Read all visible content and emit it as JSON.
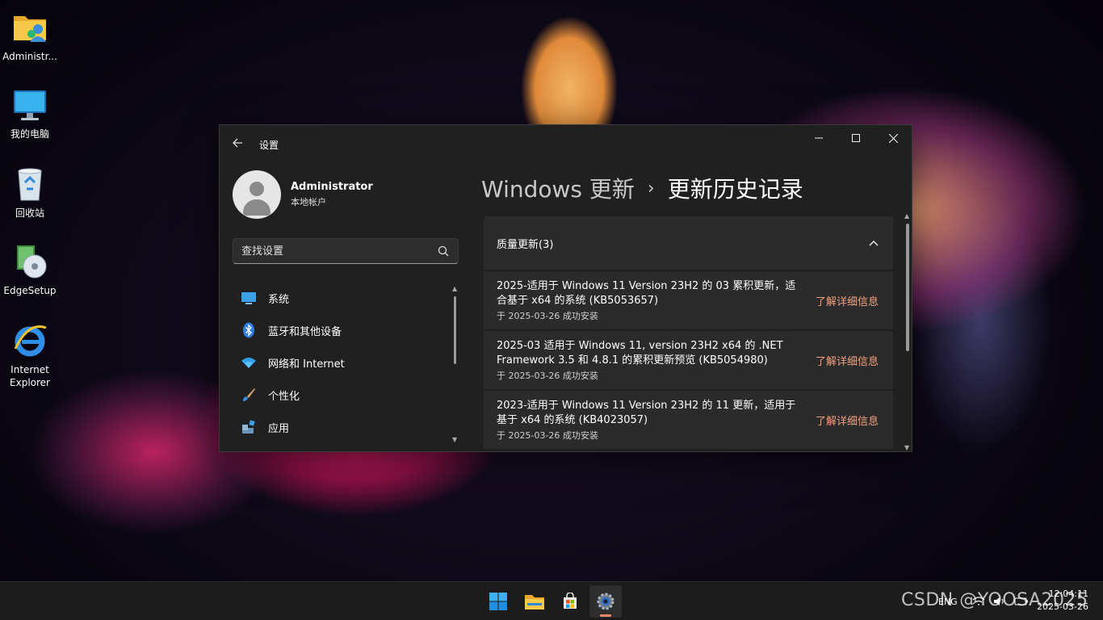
{
  "desktop": {
    "icons": [
      {
        "label": "Administr...",
        "icon": "user-folder-icon"
      },
      {
        "label": "我的电脑",
        "icon": "monitor-icon"
      },
      {
        "label": "回收站",
        "icon": "recycle-bin-icon"
      },
      {
        "label": "EdgeSetup",
        "icon": "installer-disc-icon"
      },
      {
        "label": "Internet Explorer",
        "icon": "internet-explorer-icon"
      }
    ]
  },
  "window": {
    "app_title": "设置",
    "profile": {
      "name": "Administrator",
      "account_type": "本地帐户"
    },
    "search": {
      "placeholder": "查找设置"
    },
    "nav": [
      {
        "label": "系统",
        "icon": "system-display-icon"
      },
      {
        "label": "蓝牙和其他设备",
        "icon": "bluetooth-icon"
      },
      {
        "label": "网络和 Internet",
        "icon": "wifi-icon"
      },
      {
        "label": "个性化",
        "icon": "paintbrush-icon"
      },
      {
        "label": "应用",
        "icon": "apps-icon"
      }
    ],
    "breadcrumb": {
      "parent": "Windows 更新",
      "separator": "›",
      "current": "更新历史记录"
    },
    "section": {
      "title": "质量更新(3)",
      "updates": [
        {
          "title": "2025-适用于 Windows 11 Version 23H2 的 03 累积更新，适合基于 x64 的系统 (KB5053657)",
          "date": "于 2025-03-26 成功安装",
          "link": "了解详细信息"
        },
        {
          "title": "2025-03 适用于 Windows 11, version 23H2 x64 的 .NET Framework 3.5 和 4.8.1 的累积更新预览 (KB5054980)",
          "date": "于 2025-03-26 成功安装",
          "link": "了解详细信息"
        },
        {
          "title": "2023-适用于 Windows 11 Version 23H2 的 11 更新，适用于基于 x64 的系统 (KB4023057)",
          "date": "于 2025-03-26 成功安装",
          "link": "了解详细信息"
        }
      ]
    }
  },
  "taskbar": {
    "apps": [
      "start-icon",
      "file-explorer-icon",
      "microsoft-store-icon",
      "settings-icon"
    ],
    "language": "ENG",
    "time": "12:04:11",
    "date": "2025-03-26"
  },
  "watermark": "CSDN @YOOSA2025",
  "colors": {
    "accent": "#f3a17e",
    "window_bg": "#202020",
    "card_bg": "#2b2b2b"
  }
}
